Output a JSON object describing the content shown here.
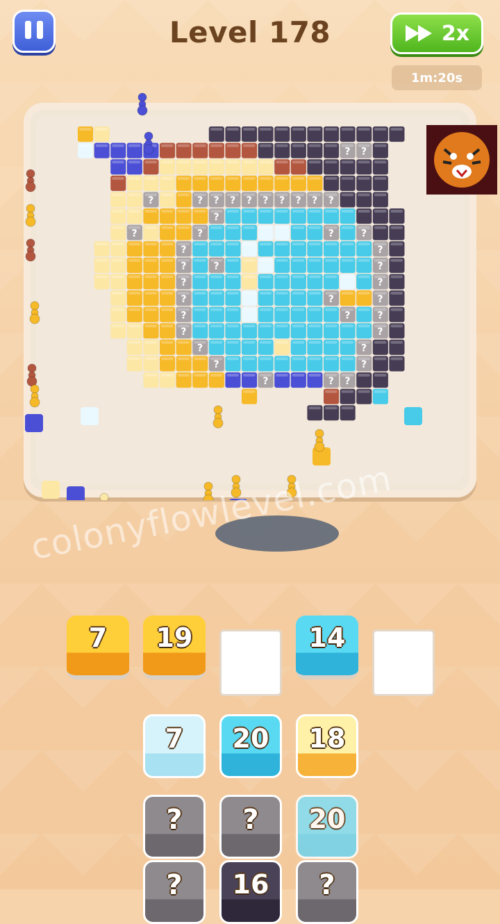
{
  "header": {
    "level_title": "Level 178",
    "speed_label": "2x",
    "timer": "1m:20s"
  },
  "icons": {
    "pause": "pause-icon",
    "fast_forward": "fast-forward-icon",
    "tiger_logo": "tiger-logo-icon"
  },
  "watermark": "colonyflowlevel.com",
  "colors": {
    "blue": "#4a4fd6",
    "yellow": "#f6b928",
    "pale": "#fce7a5",
    "cyan": "#47cbe8",
    "dark": "#463d55",
    "red": "#b3563f",
    "grey": "#a9a3a6",
    "board": "#f2e8db",
    "ui_green": "#5bbd24",
    "ui_blue": "#3f5fd8"
  },
  "slots": [
    {
      "number": "7",
      "color": "yellow"
    },
    {
      "number": "19",
      "color": "yellow"
    },
    {
      "number": "",
      "color": "empty"
    },
    {
      "number": "14",
      "color": "cyan"
    },
    {
      "number": "",
      "color": "empty"
    }
  ],
  "queue": [
    {
      "number": "7",
      "color": "pale-cyan"
    },
    {
      "number": "20",
      "color": "cyan"
    },
    {
      "number": "18",
      "color": "pale-yellow"
    },
    {
      "number": "?",
      "color": "mystery"
    },
    {
      "number": "?",
      "color": "mystery"
    },
    {
      "number": "20",
      "color": "cyan-faded"
    },
    {
      "number": "?",
      "color": "mystery"
    },
    {
      "number": "16",
      "color": "dark"
    },
    {
      "number": "?",
      "color": "mystery"
    }
  ]
}
